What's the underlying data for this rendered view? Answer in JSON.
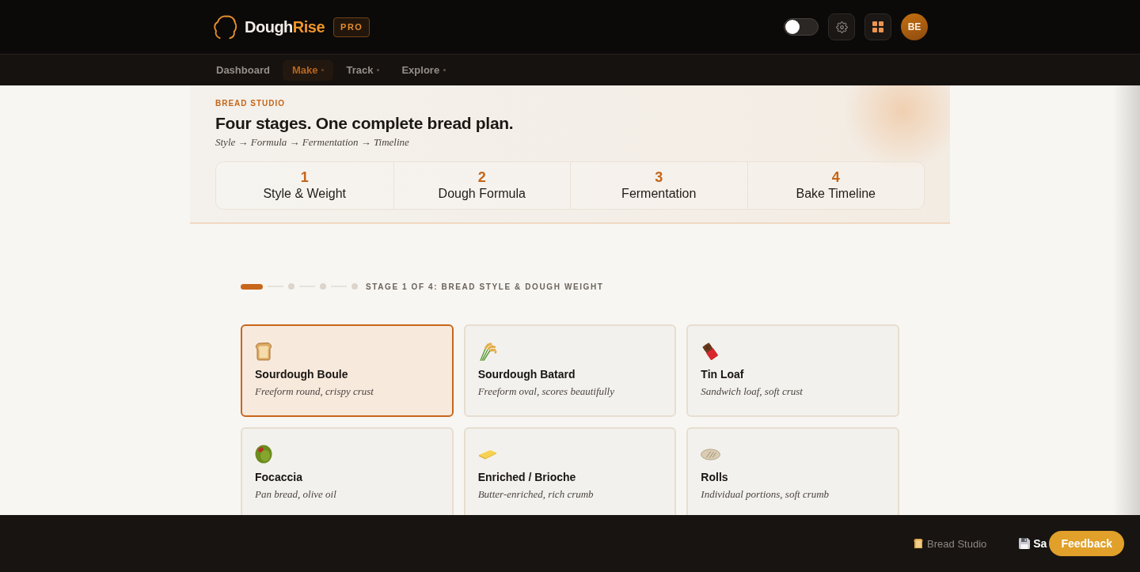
{
  "header": {
    "brand": {
      "name": "Dough",
      "name_accent": "Rise",
      "badge": "PRO"
    },
    "theme_toggle": {
      "on": false
    },
    "avatar": {
      "initials": "BE"
    }
  },
  "nav": {
    "items": [
      {
        "label": "Dashboard",
        "selected": false,
        "has_menu": false
      },
      {
        "label": "Make",
        "selected": true,
        "has_menu": true
      },
      {
        "label": "Track",
        "selected": false,
        "has_menu": true
      },
      {
        "label": "Explore",
        "selected": false,
        "has_menu": true
      }
    ]
  },
  "hero": {
    "eyebrow": "BREAD STUDIO",
    "title": "Four stages. One complete bread plan.",
    "subtitle": "Style → Formula → Fermentation → Timeline",
    "stages": [
      {
        "number": "1",
        "label": "Style & Weight"
      },
      {
        "number": "2",
        "label": "Dough Formula"
      },
      {
        "number": "3",
        "label": "Fermentation"
      },
      {
        "number": "4",
        "label": "Bake Timeline"
      }
    ]
  },
  "progress": {
    "steps": [
      {
        "current": true
      },
      {
        "current": false
      },
      {
        "current": false
      },
      {
        "current": false
      }
    ],
    "label": "STAGE 1 OF 4: BREAD STYLE & DOUGH WEIGHT"
  },
  "styles": [
    {
      "name": "Sourdough Boule",
      "description": "Freeform round, crispy crust",
      "selected": true
    },
    {
      "name": "Sourdough Batard",
      "description": "Freeform oval, scores beautifully",
      "selected": false
    },
    {
      "name": "Tin Loaf",
      "description": "Sandwich loaf, soft crust",
      "selected": false
    },
    {
      "name": "Focaccia",
      "description": "Pan bread, olive oil",
      "selected": false
    },
    {
      "name": "Enriched / Brioche",
      "description": "Butter-enriched, rich crumb",
      "selected": false
    },
    {
      "name": "Rolls",
      "description": "Individual portions, soft crumb",
      "selected": false
    }
  ],
  "footer": {
    "section": "Bread Studio",
    "save_label": "Sa",
    "feedback": "Feedback"
  }
}
